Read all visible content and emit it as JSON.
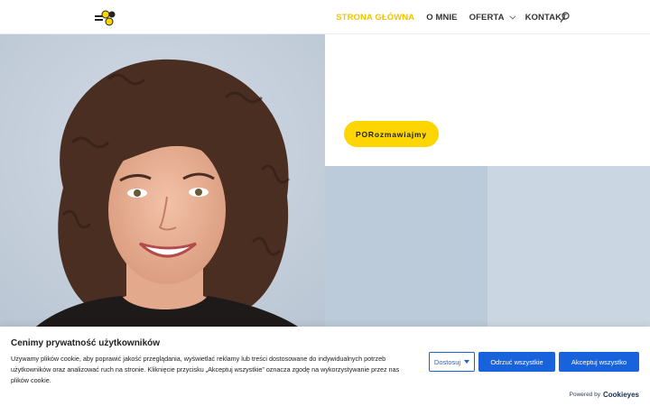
{
  "header": {
    "logo_icon": "bee-logo-icon",
    "nav": [
      {
        "label": "STRONA GŁÓWNA",
        "active": true,
        "has_dropdown": false
      },
      {
        "label": "O MNIE",
        "active": false,
        "has_dropdown": false
      },
      {
        "label": "OFERTA",
        "active": false,
        "has_dropdown": true
      },
      {
        "label": "KONTAKT",
        "active": false,
        "has_dropdown": false
      }
    ],
    "search_icon": "search-icon"
  },
  "hero": {
    "cta_label": "PORozmawiajmy"
  },
  "cookie_banner": {
    "title": "Cenimy prywatność użytkowników",
    "text": "Używamy plików cookie, aby poprawić jakość przeglądania, wyświetlać reklamy lub treści dostosowane do indywidualnych potrzeb użytkowników oraz analizować ruch na stronie. Kliknięcie przycisku „Akceptuj wszystkie” oznacza zgodę na wykorzystywanie przez nas plików cookie.",
    "customize_label": "Dostosuj",
    "reject_label": "Odrzuć wszystkie",
    "accept_label": "Akceptuj wszystko",
    "powered_by": "Powered by",
    "brand": "Cookieyes"
  },
  "colors": {
    "accent_yellow": "#fdd500",
    "nav_active": "#f2c400",
    "button_blue": "#1863dc"
  }
}
